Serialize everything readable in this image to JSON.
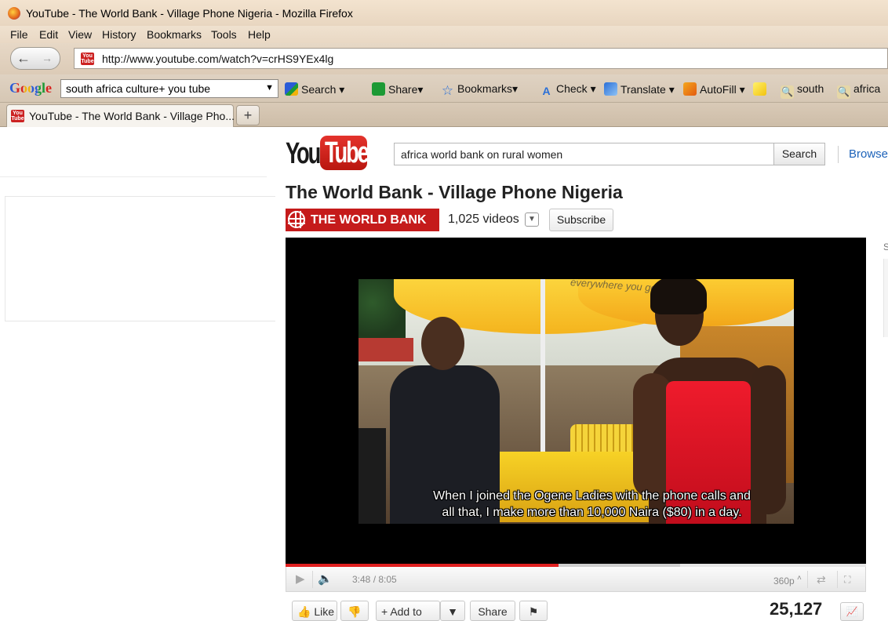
{
  "window": {
    "title": "YouTube - The World Bank - Village Phone Nigeria - Mozilla Firefox"
  },
  "menubar": {
    "items": [
      "File",
      "Edit",
      "View",
      "History",
      "Bookmarks",
      "Tools",
      "Help"
    ]
  },
  "navbar": {
    "back_icon": "←",
    "forward_icon": "→",
    "url": "http://www.youtube.com/watch?v=crHS9YEx4lg",
    "favicon_text": "You Tube"
  },
  "google_toolbar": {
    "logo": "Google",
    "search_value": "south africa culture+ you tube",
    "buttons": {
      "search": "Search",
      "share": "Share",
      "bookmarks": "Bookmarks",
      "check": "Check",
      "translate": "Translate",
      "autofill": "AutoFill",
      "south": "south",
      "africa": "africa"
    }
  },
  "tabs": {
    "active_title": "YouTube - The World Bank - Village Pho...",
    "new_tab": "+"
  },
  "youtube": {
    "logo_you": "You",
    "logo_tube": "Tube",
    "search_value": "africa world bank on rural women",
    "search_button": "Search",
    "browse": "Browse",
    "video_title": "The World Bank - Village Phone Nigeria",
    "channel_name": "THE WORLD BANK",
    "video_count": "1,025 videos",
    "subscribe": "Subscribe",
    "side_tab": "S"
  },
  "player": {
    "subtitle_line1": "When I joined the Ogene Ladies with the phone calls and",
    "subtitle_line2": "all that, I make more than 10,000 Naira ($80) in a day.",
    "frame_watermark": "everywhere you go",
    "current_time": "3:48 / 8:05",
    "quality": "360p",
    "progress_played": 0.47,
    "progress_loaded": 0.68
  },
  "actions": {
    "like": "Like",
    "add_to": "Add to",
    "share": "Share",
    "views": "25,127"
  }
}
